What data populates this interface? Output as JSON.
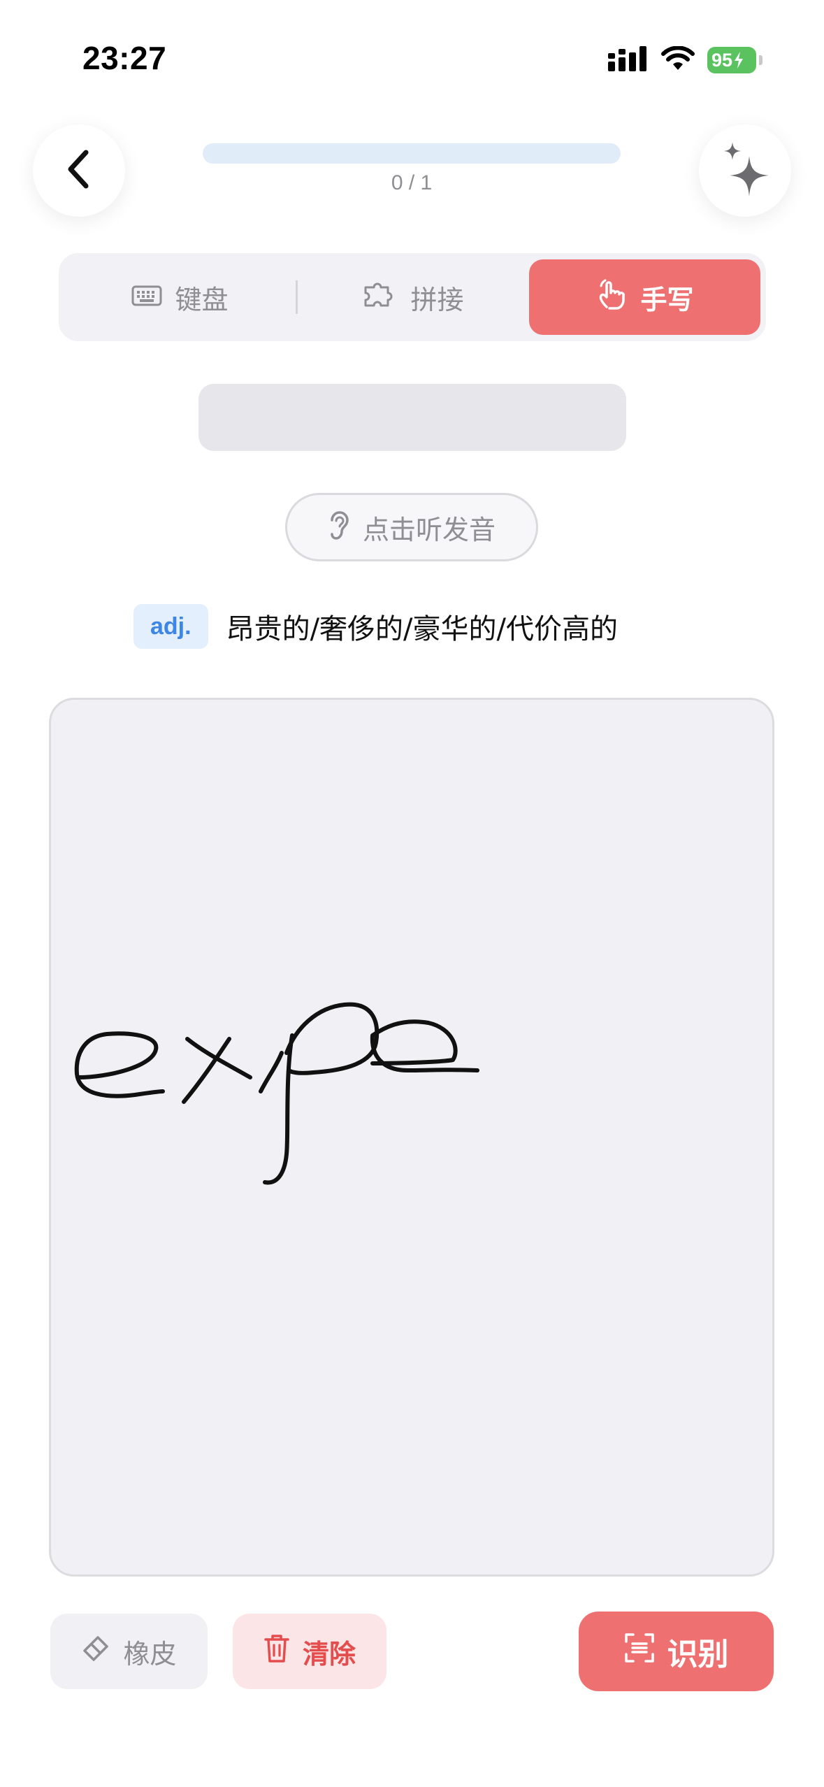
{
  "status_bar": {
    "time": "23:27",
    "battery": "95",
    "icons": [
      "signal-icon",
      "wifi-icon",
      "battery-charging-icon"
    ]
  },
  "header": {
    "progress_text": "0 / 1",
    "progress_fraction": 0,
    "back_icon": "chevron-left-icon",
    "magic_icon": "sparkles-icon"
  },
  "input_modes": {
    "keyboard": "键盘",
    "puzzle": "拼接",
    "handwrite": "手写",
    "active": "handwrite"
  },
  "pronounce": {
    "label": "点击听发音"
  },
  "definition": {
    "pos": "adj.",
    "meaning": "昂贵的/奢侈的/豪华的/代价高的"
  },
  "canvas": {
    "handwritten_text": "expe"
  },
  "tools": {
    "eraser": "橡皮",
    "clear": "清除",
    "recognize": "识别"
  },
  "colors": {
    "accent": "#ee7070",
    "progress": "#e1ecf9",
    "badge": "#3d86e6",
    "battery": "#5ac35f"
  }
}
